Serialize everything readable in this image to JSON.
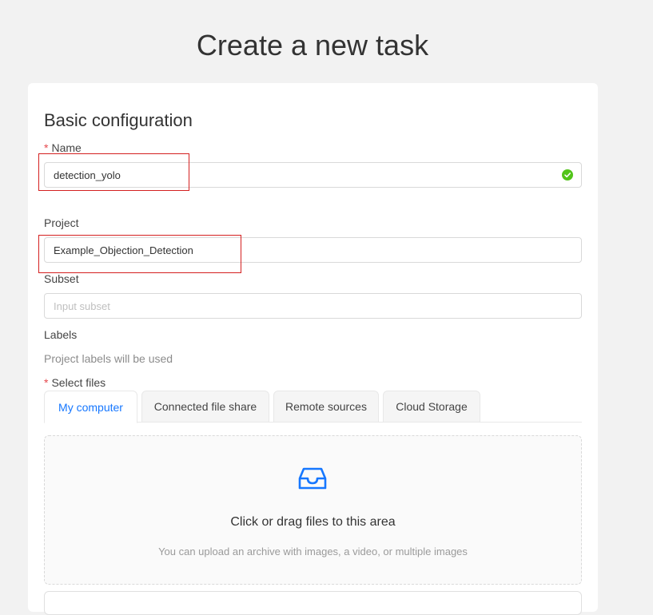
{
  "page": {
    "title": "Create a new task"
  },
  "basic": {
    "section_title": "Basic configuration",
    "name": {
      "label": "Name",
      "required": "*",
      "value": "detection_yolo"
    },
    "project": {
      "label": "Project",
      "value": "Example_Objection_Detection"
    },
    "subset": {
      "label": "Subset",
      "placeholder": "Input subset"
    },
    "labels": {
      "label": "Labels",
      "hint": "Project labels will be used"
    },
    "files": {
      "label": "Select files",
      "required": "*",
      "tabs": [
        {
          "label": "My computer",
          "active": true
        },
        {
          "label": "Connected file share"
        },
        {
          "label": "Remote sources"
        },
        {
          "label": "Cloud Storage"
        }
      ],
      "dropzone": {
        "icon": "inbox-icon",
        "text": "Click or drag files to this area",
        "hint": "You can upload an archive with images, a video, or multiple images"
      }
    }
  },
  "colors": {
    "accent": "#1677ff",
    "success": "#52c41a",
    "required": "#e5484d",
    "highlight": "#d42020"
  }
}
